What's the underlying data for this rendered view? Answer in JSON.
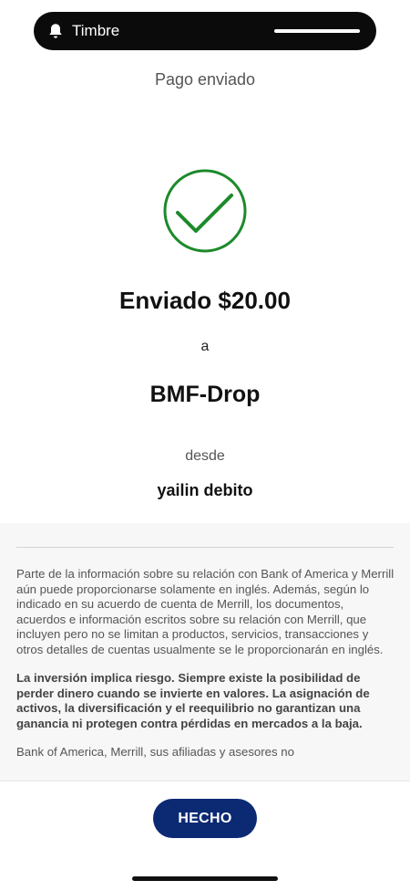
{
  "notification": {
    "label": "Timbre",
    "icon": "bell-icon"
  },
  "header": {
    "title": "Pago enviado"
  },
  "status": {
    "icon": "checkmark-circle-icon",
    "success_color": "#1c8a2a"
  },
  "summary": {
    "amount_line": "Enviado $20.00",
    "to_word": "a",
    "recipient": "BMF-Drop",
    "from_word": "desde",
    "source": "yailin debito"
  },
  "disclaimer": {
    "paragraphs": [
      "Parte de la información sobre su relación con Bank of America y Merrill aún puede proporcionarse solamente en inglés. Además, según lo indicado en su acuerdo de cuenta de Merrill, los documentos, acuerdos e información escritos sobre su relación con Merrill, que incluyen pero no se limitan a productos, servicios, transacciones y otros detalles de cuentas usualmente se le proporcionarán en inglés.",
      "La inversión implica riesgo. Siempre existe la posibilidad de perder dinero cuando se invierte en valores. La asignación de activos, la diversificación y el reequilibrio no garantizan una ganancia ni protegen contra pérdidas en mercados a la baja.",
      "Bank of America, Merrill, sus afiliadas y asesores no"
    ]
  },
  "footer": {
    "done_label": "HECHO",
    "button_color": "#0c2a73"
  }
}
